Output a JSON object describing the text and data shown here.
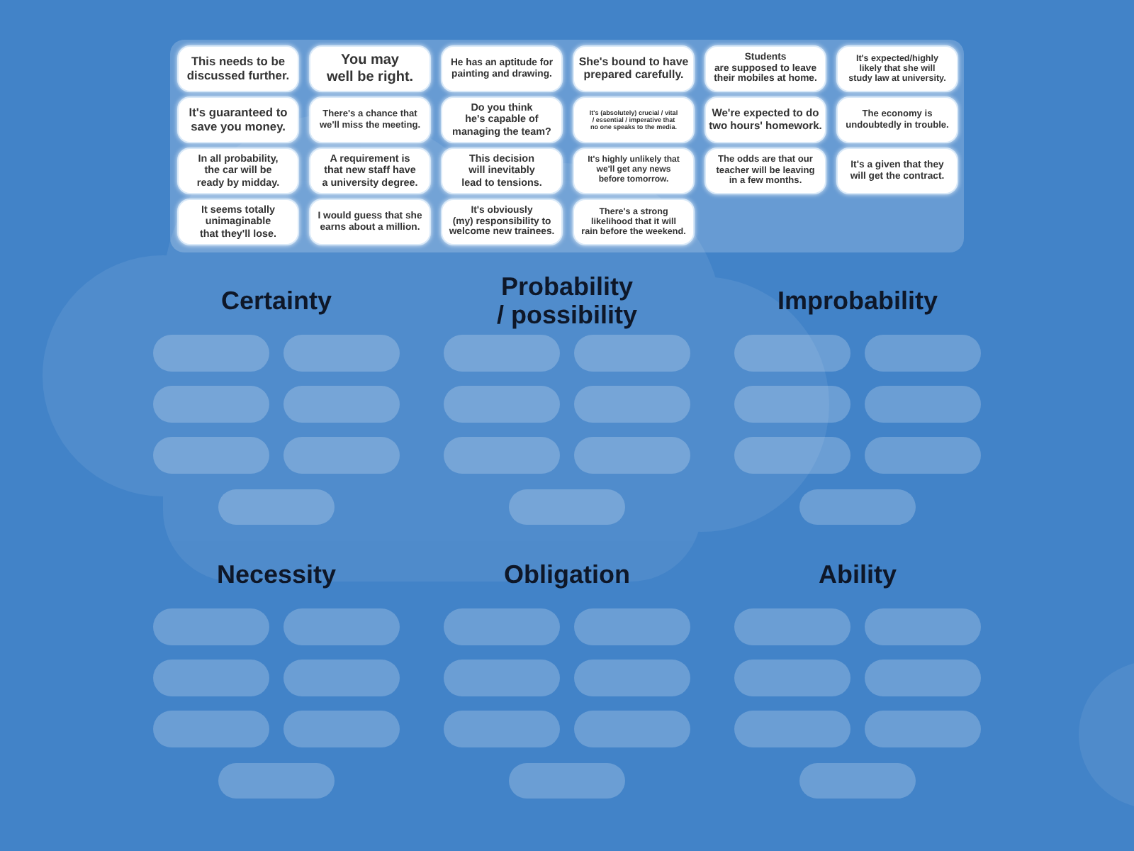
{
  "panel": {
    "cards": [
      "This needs to be\ndiscussed further.",
      "You may\nwell be right.",
      "He has an aptitude for\npainting and drawing.",
      "She's bound to have\nprepared carefully.",
      "Students\nare supposed to leave\ntheir mobiles at home.",
      "It's expected/highly\nlikely that she will\nstudy law at university.",
      "It's guaranteed to\nsave you money.",
      "There's a chance that\nwe'll miss the meeting.",
      "Do you think\nhe's capable of\nmanaging the team?",
      "It's (absolutely) crucial / vital\n/ essential / imperative that\nno one speaks to the media.",
      "We're expected to do\ntwo hours' homework.",
      "The economy is\nundoubtedly in trouble.",
      "In all probability,\nthe car will be\nready by midday.",
      "A requirement is\nthat new staff have\na university degree.",
      "This decision\nwill inevitably\nlead to tensions.",
      "It's highly unlikely that\nwe'll get any news\nbefore tomorrow.",
      "The odds are that our\nteacher will be leaving\nin a few months.",
      "It's a given that they\nwill get the contract.",
      "It seems totally\nunimaginable\nthat they'll lose.",
      "I would guess that she\nearns about a million.",
      "It's obviously\n(my) responsibility to\nwelcome new trainees.",
      "There's a strong\nlikelihood that it will\nrain before the weekend."
    ]
  },
  "groups": [
    {
      "heading": "Certainty",
      "slots": [
        {
          "filled": false
        },
        {
          "filled": false
        },
        {
          "filled": false
        },
        {
          "filled": false
        },
        {
          "filled": false
        },
        {
          "filled": false
        },
        {
          "filled": false
        }
      ]
    },
    {
      "heading": "Probability\n/ possibility",
      "slots": [
        {
          "filled": false
        },
        {
          "filled": false
        },
        {
          "filled": false
        },
        {
          "filled": false
        },
        {
          "filled": false
        },
        {
          "filled": false
        },
        {
          "filled": false
        }
      ]
    },
    {
      "heading": "Improbability",
      "slots": [
        {
          "filled": false
        },
        {
          "filled": false
        },
        {
          "filled": false
        },
        {
          "filled": false
        },
        {
          "filled": false
        },
        {
          "filled": false
        },
        {
          "filled": false
        }
      ]
    },
    {
      "heading": "Necessity",
      "slots": [
        {
          "filled": false
        },
        {
          "filled": false
        },
        {
          "filled": false
        },
        {
          "filled": false
        },
        {
          "filled": false
        },
        {
          "filled": false
        },
        {
          "filled": false
        }
      ]
    },
    {
      "heading": "Obligation",
      "slots": [
        {
          "filled": false
        },
        {
          "filled": false
        },
        {
          "filled": false
        },
        {
          "filled": false
        },
        {
          "filled": false
        },
        {
          "filled": false
        },
        {
          "filled": false
        }
      ]
    },
    {
      "heading": "Ability",
      "slots": [
        {
          "filled": false
        },
        {
          "filled": false
        },
        {
          "filled": false
        },
        {
          "filled": false
        },
        {
          "filled": false
        },
        {
          "filled": false
        },
        {
          "filled": false
        }
      ]
    }
  ]
}
